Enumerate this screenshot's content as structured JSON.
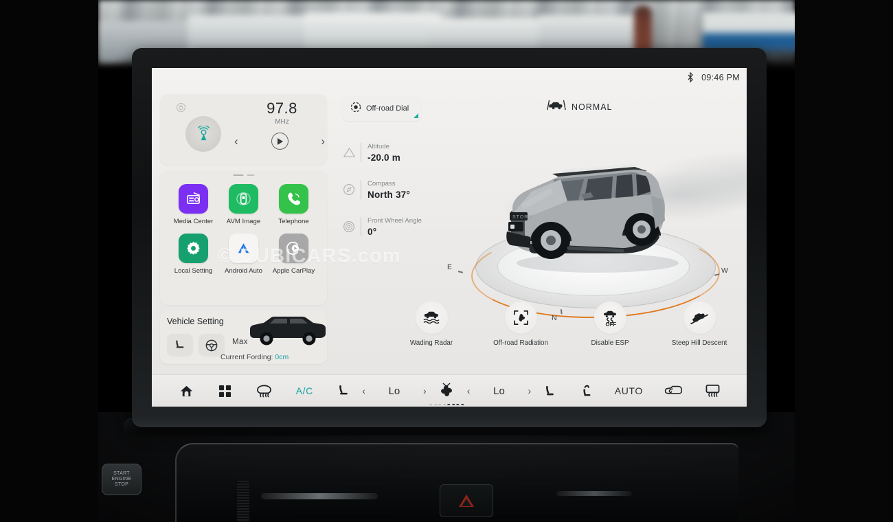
{
  "statusbar": {
    "bluetooth_icon": "bluetooth-icon",
    "time": "09:46 PM"
  },
  "radio": {
    "frequency": "97.8",
    "unit": "MHz",
    "source_icon": "radio-tower-icon",
    "prev_label": "‹",
    "next_label": "›",
    "play_icon": "play-icon"
  },
  "apps": [
    {
      "label": "Media Center",
      "icon": "radio-media-icon",
      "color": "#7b2ff2"
    },
    {
      "label": "AVM Image",
      "icon": "surround-view-icon",
      "color": "#1fbb63"
    },
    {
      "label": "Telephone",
      "icon": "phone-icon",
      "color": "#34c24a"
    },
    {
      "label": "Local Setting",
      "icon": "gear-icon",
      "color": "#17a06f"
    },
    {
      "label": "Android Auto",
      "icon": "android-auto-icon",
      "color": "#f5f4f2"
    },
    {
      "label": "Apple CarPlay",
      "icon": "carplay-icon",
      "color": "#a8a8a8"
    }
  ],
  "vehicle_setting": {
    "title": "Vehicle Setting",
    "seat_icon": "seat-icon",
    "steering_icon": "steering-wheel-icon",
    "max_label": "Max",
    "fording_label": "Current Fording:",
    "fording_value": "0cm"
  },
  "offroad_dial": {
    "label": "Off-road Dial",
    "icon": "dial-icon"
  },
  "drive_mode": {
    "label": "NORMAL",
    "icon": "drive-mode-car-icon"
  },
  "info": [
    {
      "icon": "mountain-icon",
      "label": "Altitude",
      "value": "-20.0 m"
    },
    {
      "icon": "compass-icon",
      "label": "Compass",
      "value": "North 37°"
    },
    {
      "icon": "wheel-angle-icon",
      "label": "Front Wheel Angle",
      "value": "0°"
    }
  ],
  "compass_disc": {
    "east": "E",
    "west": "W",
    "north": "N",
    "arc_color": "#e07b22"
  },
  "watermark": "© DUBICARS.com",
  "functions": [
    {
      "label": "Wading Radar",
      "icon": "wading-radar-icon"
    },
    {
      "label": "Off-road Radiation",
      "icon": "offroad-radiation-icon"
    },
    {
      "label": "Disable ESP",
      "icon": "esp-off-icon"
    },
    {
      "label": "Steep Hill Descent",
      "icon": "hill-descent-icon"
    }
  ],
  "bottombar": {
    "home_icon": "home-icon",
    "apps_icon": "grid-apps-icon",
    "defrost_front_icon": "front-defrost-icon",
    "ac_label": "A/C",
    "seat_left_icon": "seat-left-icon",
    "temp_left": "Lo",
    "fan_icon": "fan-icon",
    "temp_right": "Lo",
    "seat_heat_icon": "seat-heat-icon",
    "seat_vent_icon": "seat-vent-icon",
    "auto_label": "AUTO",
    "recirculate_icon": "air-recirculate-icon",
    "defrost_rear_icon": "rear-defrost-icon",
    "prev_chevron": "‹",
    "next_chevron": "›",
    "fan_levels_total": 8,
    "fan_levels_on": 4
  },
  "dashboard": {
    "start_stop_label": "START\nENGINE\nSTOP",
    "hazard_icon": "hazard-triangle-icon"
  },
  "colors": {
    "accent": "#17a3a0",
    "orange_arc": "#e07b22",
    "screen_bg": "#eceae8"
  }
}
